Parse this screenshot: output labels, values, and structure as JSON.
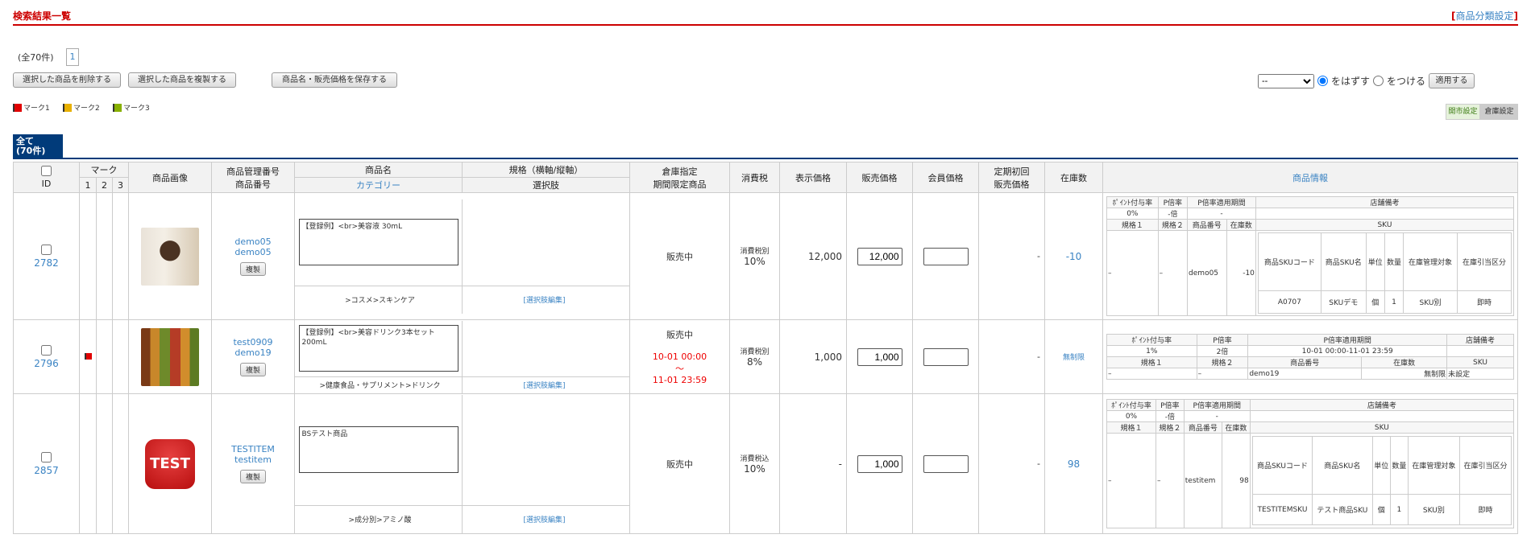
{
  "header": {
    "title": "検索結果一覧",
    "right_bracket_open": "[",
    "right_link": "商品分類設定",
    "right_bracket_close": "]"
  },
  "list": {
    "count": "(全70件)",
    "page": "1"
  },
  "buttons": {
    "delete": "選択した商品を削除する",
    "copy": "選択した商品を複製する",
    "save": "商品名・販売価格を保存する",
    "apply": "適用する"
  },
  "marks": [
    {
      "label": "マーク1",
      "color": "#e00000"
    },
    {
      "label": "マーク2",
      "color": "#e8b000"
    },
    {
      "label": "マーク3",
      "color": "#88b000"
    }
  ],
  "filter": {
    "select_value": "--",
    "radio_remove": "をはずす",
    "radio_add": "をつける"
  },
  "toggle": {
    "a": "開市設定",
    "b": "倉庫設定"
  },
  "tab": {
    "line1": "全て",
    "line2": "(70件)"
  },
  "columns": {
    "id": "ID",
    "mark": "マーク",
    "m1": "1",
    "m2": "2",
    "m3": "3",
    "image": "商品画像",
    "mgmt1": "商品管理番号",
    "mgmt2": "商品番号",
    "name": "商品名",
    "category": "カテゴリー",
    "spec": "規格（横軸/縦軸）",
    "choice": "選択肢",
    "warehouse1": "倉庫指定",
    "warehouse2": "期間限定商品",
    "tax": "消費税",
    "display_price": "表示価格",
    "sale_price": "販売価格",
    "member_price": "会員価格",
    "sub1": "定期初回",
    "sub2": "販売価格",
    "stock": "在庫数",
    "info": "商品情報"
  },
  "info_headers": {
    "pt": "ﾎﾟｲﾝﾄ付与率",
    "prate": "P倍率",
    "pperiod": "P倍率適用期間",
    "memo": "店舗備考",
    "spec1": "規格１",
    "spec2": "規格２",
    "code": "商品番号",
    "stock": "在庫数",
    "sku": "SKU",
    "sku_code": "商品SKUコード",
    "sku_name": "商品SKU名",
    "unit": "単位",
    "qty": "数量",
    "stock_mgmt": "在庫管理対象",
    "stock_sep": "SKU別",
    "draw": "在庫引当区分",
    "immediate": "即時"
  },
  "rows": [
    {
      "id": "2782",
      "mgmt": "demo05",
      "code": "demo05",
      "copy": "複製",
      "name": "【登録例】<br>美容液 30mL",
      "category": ">コスメ>スキンケア",
      "choice": "[選択肢編集]",
      "status": "販売中",
      "period_start": "",
      "period_sep": "",
      "period_end": "",
      "tax_type": "消費税別",
      "tax_rate": "10%",
      "display_price": "12,000",
      "sale_price": "12,000",
      "sub_price": "-",
      "stock": "-10",
      "pt": "0%",
      "prate": "-倍",
      "pperiod": "-",
      "s1": "–",
      "s2": "–",
      "icode": "demo05",
      "istock": "-10",
      "sku_code": "A0707",
      "sku_name": "SKUデモ",
      "unit": "個",
      "qty": "1"
    },
    {
      "id": "2796",
      "mgmt": "test0909",
      "code": "demo19",
      "copy": "複製",
      "name": "【登録例】<br>美容ドリンク3本セット 200mL",
      "category": ">健康食品・サプリメント>ドリンク",
      "choice": "[選択肢編集]",
      "status": "販売中",
      "period_start": "10-01 00:00",
      "period_sep": "〜",
      "period_end": "11-01 23:59",
      "tax_type": "消費税別",
      "tax_rate": "8%",
      "display_price": "1,000",
      "sale_price": "1,000",
      "sub_price": "-",
      "stock": "無制限",
      "pt": "1%",
      "prate": "2倍",
      "pperiod": "10-01 00:00-11-01 23:59",
      "s1": "–",
      "s2": "–",
      "icode": "demo19",
      "istock": "無制限",
      "sku_unset": "未設定"
    },
    {
      "id": "2857",
      "mgmt": "TESTITEM",
      "code": "testitem",
      "copy": "複製",
      "name": "BSテスト商品",
      "category": ">成分別>アミノ酸",
      "choice": "[選択肢編集]",
      "status": "販売中",
      "tax_type": "消費税込",
      "tax_rate": "10%",
      "display_price": "-",
      "sale_price": "1,000",
      "sub_price": "-",
      "stock": "98",
      "pt": "0%",
      "prate": "-倍",
      "pperiod": "-",
      "s1": "–",
      "s2": "–",
      "icode": "testitem",
      "istock": "98",
      "sku_code": "TESTITEMSKU",
      "sku_name": "テスト商品SKU",
      "unit": "個",
      "qty": "1",
      "thumb_text": "TEST"
    }
  ]
}
